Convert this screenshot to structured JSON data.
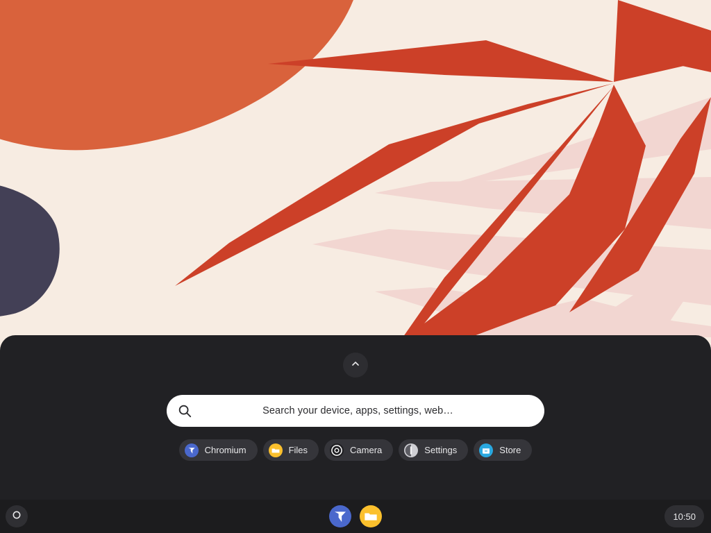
{
  "wallpaper": {
    "name": "abstract-leaves-wallpaper",
    "background_color": "#f7ece2",
    "blob_color": "#d9623c",
    "leaf_color": "#cc4028",
    "pale_leaf_color": "#f2d6d1",
    "dark_leaf_color": "#434056"
  },
  "launcher": {
    "panel_color": "#212124",
    "collapse_button": {
      "icon": "chevron-up-icon",
      "label": "Collapse launcher"
    },
    "search": {
      "icon": "search-icon",
      "value": "",
      "placeholder": "Search your device, apps, settings, web…"
    },
    "app_chips": [
      {
        "label": "Chromium",
        "icon": "chromium-icon",
        "color": "#4a68cc"
      },
      {
        "label": "Files",
        "icon": "files-folder-icon",
        "color": "#fbc02d"
      },
      {
        "label": "Camera",
        "icon": "camera-icon",
        "color": "#1f1f22"
      },
      {
        "label": "Settings",
        "icon": "settings-icon",
        "color": "#cfcfd4"
      },
      {
        "label": "Store",
        "icon": "store-bag-icon",
        "color": "#29a8e0"
      }
    ]
  },
  "shelf": {
    "background_color": "#1c1c1e",
    "launcher_button": {
      "icon": "launcher-circle-icon",
      "label": "Launcher"
    },
    "pinned_apps": [
      {
        "label": "Chromium",
        "icon": "chromium-icon",
        "color": "#4a68cc"
      },
      {
        "label": "Files",
        "icon": "files-folder-icon",
        "color": "#fbc02d"
      }
    ],
    "clock": {
      "time": "10:50"
    }
  }
}
